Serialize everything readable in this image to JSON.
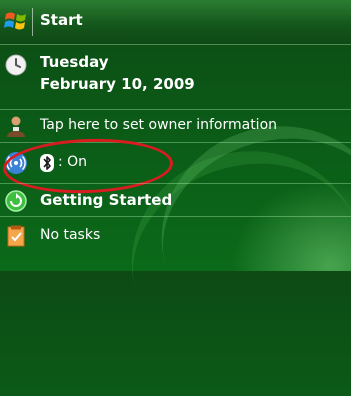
{
  "start": {
    "label": "Start"
  },
  "date": {
    "weekday": "Tuesday",
    "full_date": "February 10, 2009"
  },
  "owner": {
    "label": "Tap here to set owner information"
  },
  "bluetooth": {
    "status": ": On"
  },
  "getting_started": {
    "label": "Getting Started"
  },
  "tasks": {
    "label": "No tasks"
  },
  "colors": {
    "background": "#0b5a17",
    "highlight_oval": "#d81c20"
  },
  "icons": [
    "windows-logo-icon",
    "clock-icon",
    "owner-person-icon",
    "wireless-icon",
    "bluetooth-icon",
    "getting-started-icon",
    "tasks-icon"
  ]
}
